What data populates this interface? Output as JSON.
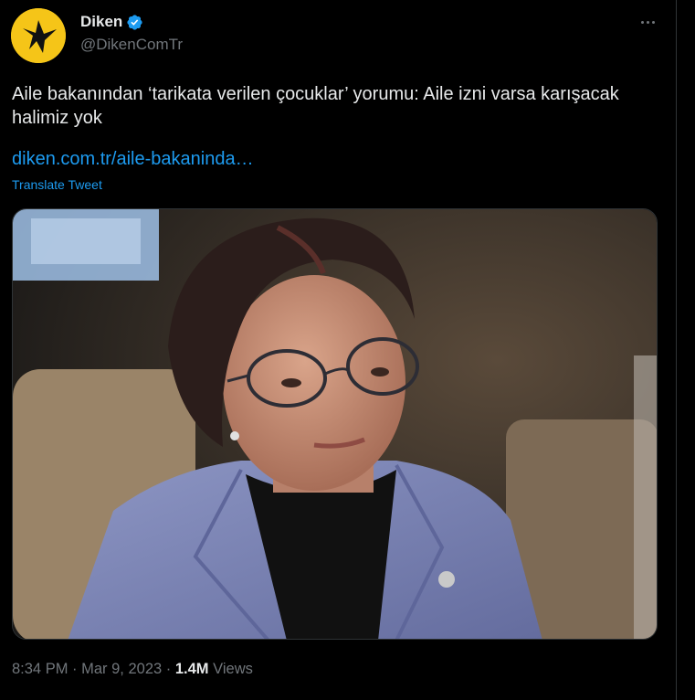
{
  "tweet": {
    "display_name": "Diken",
    "handle": "@DikenComTr",
    "text": "Aile bakanından ‘tarikata verilen çocuklar’ yorumu: Aile izni varsa karışacak halimiz yok",
    "link_text": "diken.com.tr/aile-bakaninda…",
    "translate_label": "Translate Tweet",
    "time": "8:34 PM",
    "separator": " · ",
    "date": "Mar 9, 2023",
    "views_count": "1.4M",
    "views_label": "Views"
  },
  "icons": {
    "avatar": "diken-logo",
    "verified": "verified-badge-icon",
    "more": "more-options-icon"
  },
  "colors": {
    "background": "#000000",
    "text": "#e7e9ea",
    "secondary_text": "#71767b",
    "link": "#1d9bf0",
    "verified": "#1d9bf0",
    "logo_yellow": "#f5c518"
  }
}
